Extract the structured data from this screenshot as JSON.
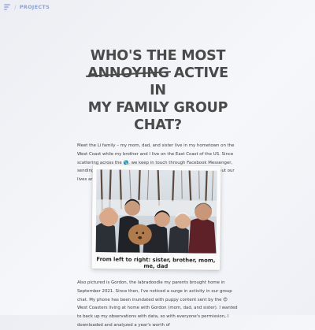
{
  "header": {
    "nav_label": "PROJECTS",
    "separator": "/"
  },
  "article": {
    "title_line1": "WHO'S THE MOST",
    "title_struck": "ANNOYING",
    "title_line2_rest": " ACTIVE IN",
    "title_line3": "MY FAMILY GROUP",
    "title_line4": "CHAT?",
    "intro_part1": "Meet the Li family – my mom, dad, and sister live in my hometown on the West Coast while my brother and I live on the East Coast of the US. Since scattering across the ",
    "intro_globe": "🌎",
    "intro_part2": ", we keep in touch through Facebook Messenger, sending each other anything and everything, including updates about our lives and a lot of food pics.",
    "photo_caption": "From left to right: sister, brother, mom, me, dad",
    "para2_part1": "Also pictured is Gordon, the labradoodle my parents brought home in September 2021. Since then, I've noticed a surge in activity in our group chat. My phone has been inundated with puppy content sent by the ",
    "para2_emoji": "😍",
    "para2_part2": " West Coasters living at home with Gordon (mom, dad, and sister). I wanted to back up my observations with data, so with everyone's permission, I downloaded and analyzed a year's worth of"
  },
  "colors": {
    "accent": "#8aa2d8",
    "title": "#4a4a4a",
    "text": "#3d3d3d"
  }
}
